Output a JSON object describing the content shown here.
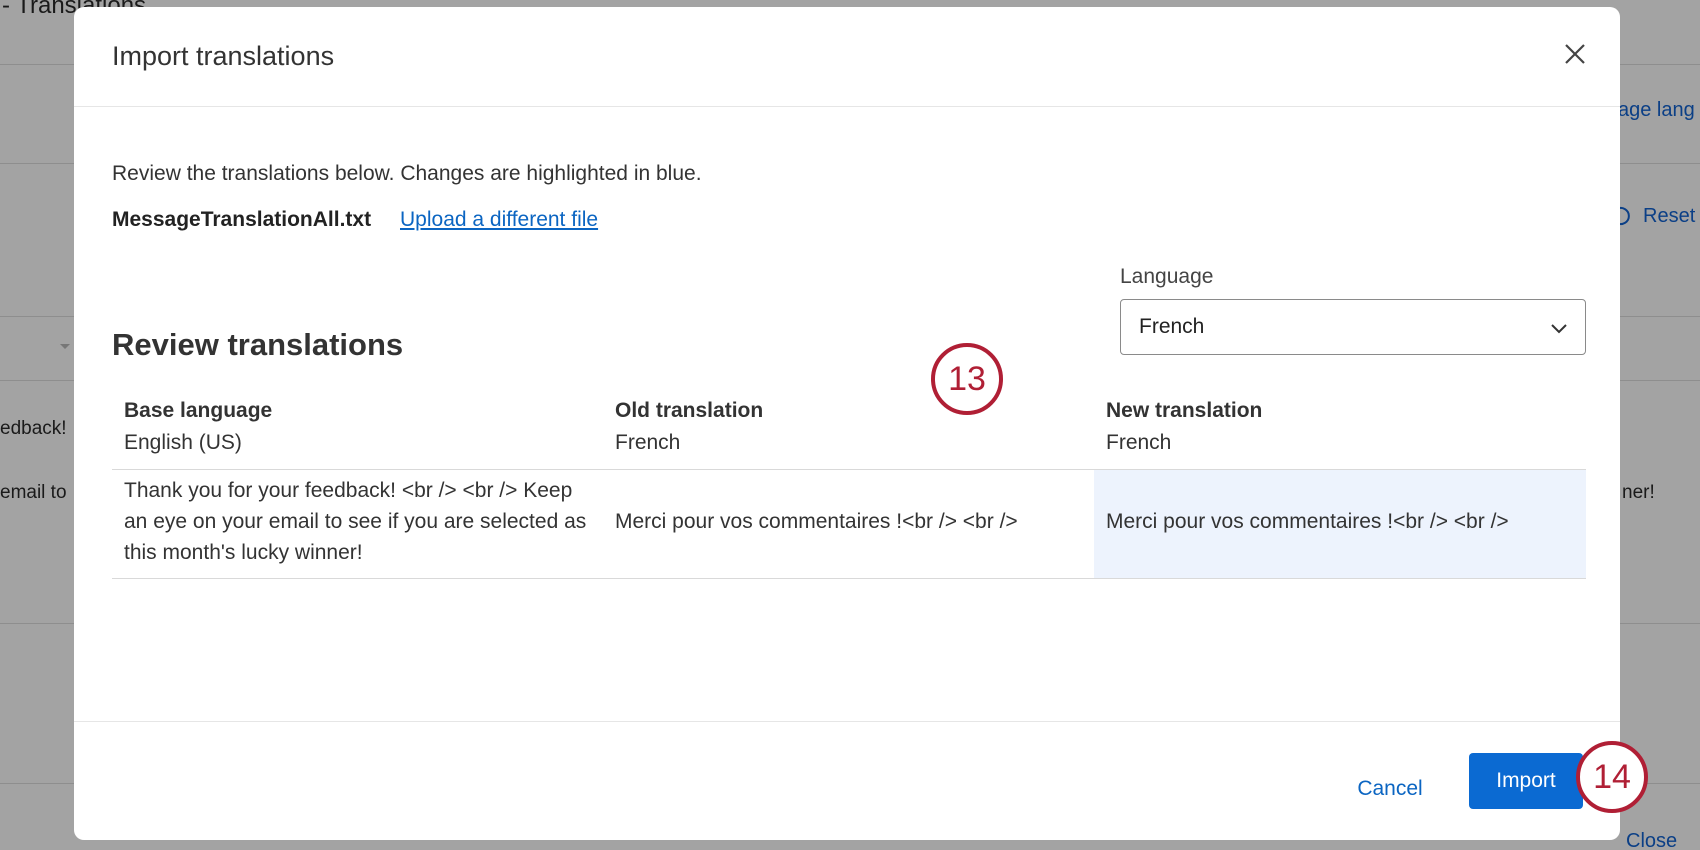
{
  "background": {
    "title_fragment": "- Translations",
    "manage_link_fragment": "age lang",
    "reset_label": "Reset",
    "row_fragment_1": "edback!",
    "row_fragment_2": "email to",
    "row_fragment_3": "ner!",
    "close_label": "Close"
  },
  "modal": {
    "title": "Import translations",
    "intro": "Review the translations below. Changes are highlighted in blue.",
    "file_name": "MessageTranslationAll.txt",
    "upload_link": "Upload a different file",
    "language_label": "Language",
    "language_value": "French",
    "review_title": "Review translations",
    "table": {
      "columns": [
        {
          "name": "Base language",
          "sub": "English (US)"
        },
        {
          "name": "Old translation",
          "sub": "French"
        },
        {
          "name": "New translation",
          "sub": "French"
        }
      ],
      "rows": [
        {
          "base": "Thank you for your feedback! <br /> <br /> Keep an eye on your email to see if you are selected as this month's lucky winner!",
          "old": "Merci pour vos commentaires !<br /> <br />",
          "new": "Merci pour vos commentaires !<br /> <br />"
        }
      ]
    },
    "cancel_label": "Cancel",
    "import_label": "Import"
  },
  "markers": {
    "step_13": "13",
    "step_14": "14"
  },
  "colors": {
    "accent": "#0b6ad2",
    "highlight": "#edf3fd",
    "marker": "#b01f35"
  }
}
